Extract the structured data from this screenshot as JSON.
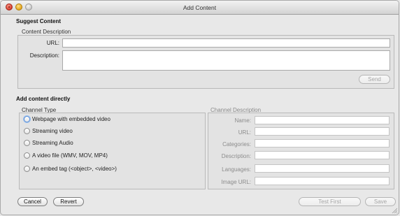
{
  "window": {
    "title": "Add Content"
  },
  "suggest": {
    "heading": "Suggest Content",
    "group_label": "Content Description",
    "url_label": "URL:",
    "url_value": "",
    "description_label": "Description:",
    "description_value": "",
    "send_label": "Send"
  },
  "direct": {
    "heading": "Add content directly",
    "channel_type_label": "Channel Type",
    "options": [
      {
        "label": "Webpage with embedded video",
        "focused": true
      },
      {
        "label": "Streaming video"
      },
      {
        "label": "Streaming Audio"
      },
      {
        "label": "A video file (WMV, MOV, MP4)"
      },
      {
        "label": "An embed tag (<object>, <video>)"
      }
    ],
    "channel_description_label": "Channel Description",
    "fields": [
      {
        "label": "Name:",
        "value": ""
      },
      {
        "label": "URL:",
        "value": ""
      },
      {
        "label": "Categories:",
        "value": ""
      },
      {
        "label": "Description:",
        "value": ""
      },
      {
        "label": "Languages:",
        "value": ""
      },
      {
        "label": "Image URL:",
        "value": ""
      }
    ]
  },
  "buttons": {
    "cancel": "Cancel",
    "revert": "Revert",
    "test_first": "Test First",
    "save": "Save"
  }
}
